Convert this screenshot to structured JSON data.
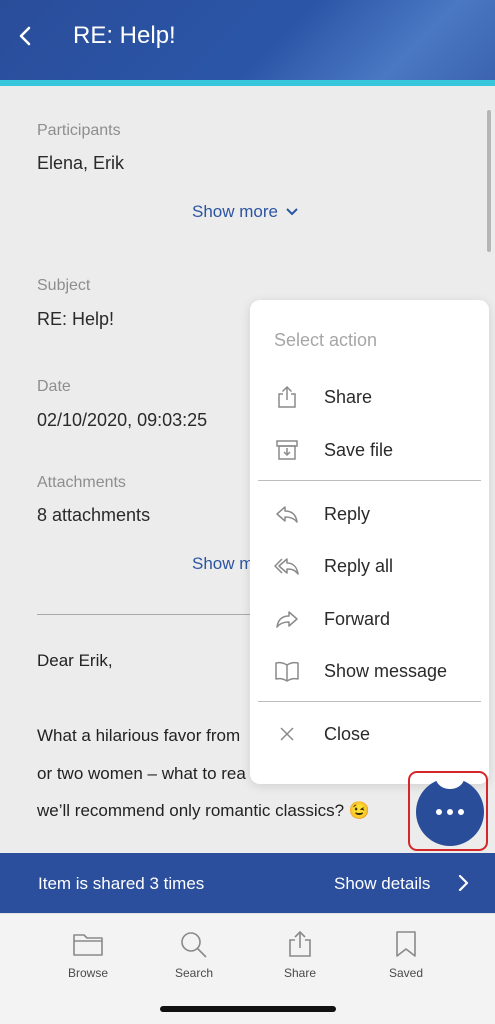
{
  "header": {
    "title": "RE: Help!"
  },
  "details": {
    "participants_label": "Participants",
    "participants_value": "Elena, Erik",
    "show_more_1": "Show more",
    "subject_label": "Subject",
    "subject_value": "RE: Help!",
    "date_label": "Date",
    "date_value": "02/10/2020, 09:03:25",
    "attachments_label": "Attachments",
    "attachments_value": "8 attachments",
    "show_more_2": "Show m"
  },
  "body": {
    "greeting": "Dear Erik,",
    "line1": "What a hilarious favor from",
    "line2": "or two women – what to rea",
    "line3": "we’ll recommend only romantic classics? 😉"
  },
  "menu": {
    "title": "Select action",
    "items": [
      {
        "label": "Share",
        "icon": "share-icon"
      },
      {
        "label": "Save file",
        "icon": "save-file-icon"
      },
      {
        "label": "Reply",
        "icon": "reply-icon"
      },
      {
        "label": "Reply all",
        "icon": "reply-all-icon"
      },
      {
        "label": "Forward",
        "icon": "forward-icon"
      },
      {
        "label": "Show message",
        "icon": "book-icon"
      },
      {
        "label": "Close",
        "icon": "close-icon"
      }
    ]
  },
  "share_bar": {
    "text": "Item is shared 3 times",
    "details": "Show details"
  },
  "tabs": [
    {
      "label": "Browse",
      "icon": "folder-icon"
    },
    {
      "label": "Search",
      "icon": "search-icon"
    },
    {
      "label": "Share",
      "icon": "share-icon"
    },
    {
      "label": "Saved",
      "icon": "bookmark-icon"
    }
  ],
  "colors": {
    "brand_blue": "#2a4d9a",
    "accent_cyan": "#38c6dc",
    "link_blue": "#2c55a2",
    "highlight_red": "#d5272b"
  }
}
